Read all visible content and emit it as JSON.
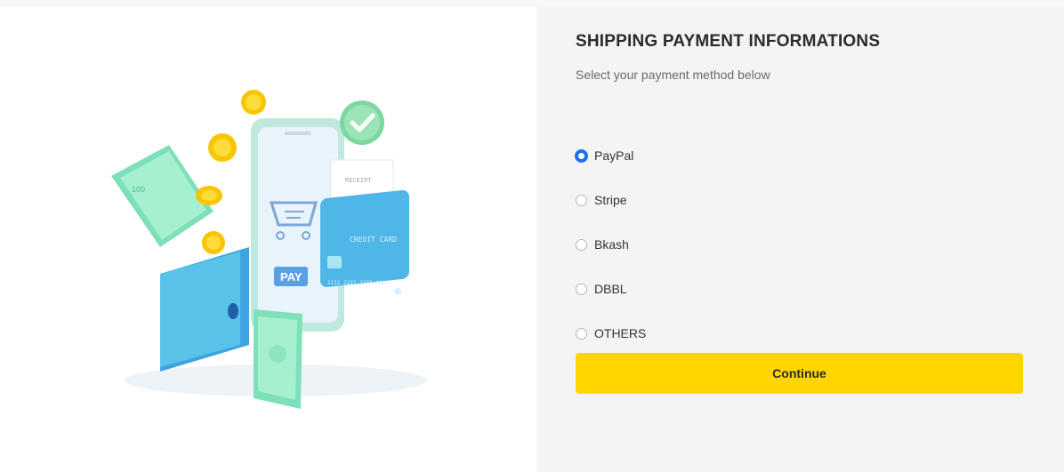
{
  "payment": {
    "title": "SHIPPING PAYMENT INFORMATIONS",
    "subtitle": "Select your payment method below",
    "methods": [
      {
        "label": "PayPal",
        "selected": true
      },
      {
        "label": "Stripe",
        "selected": false
      },
      {
        "label": "Bkash",
        "selected": false
      },
      {
        "label": "DBBL",
        "selected": false
      },
      {
        "label": "OTHERS",
        "selected": false
      }
    ],
    "continue_label": "Continue"
  },
  "illustration": {
    "receipt_label": "RECEIPT",
    "card_label": "CREDIT CARD",
    "card_number": "1111 2222 3333 4444",
    "pay_label": "PAY",
    "bill_value": "100"
  },
  "colors": {
    "accent_blue": "#1e6ff0",
    "button_yellow": "#ffd600",
    "panel_bg": "#f4f4f4"
  }
}
